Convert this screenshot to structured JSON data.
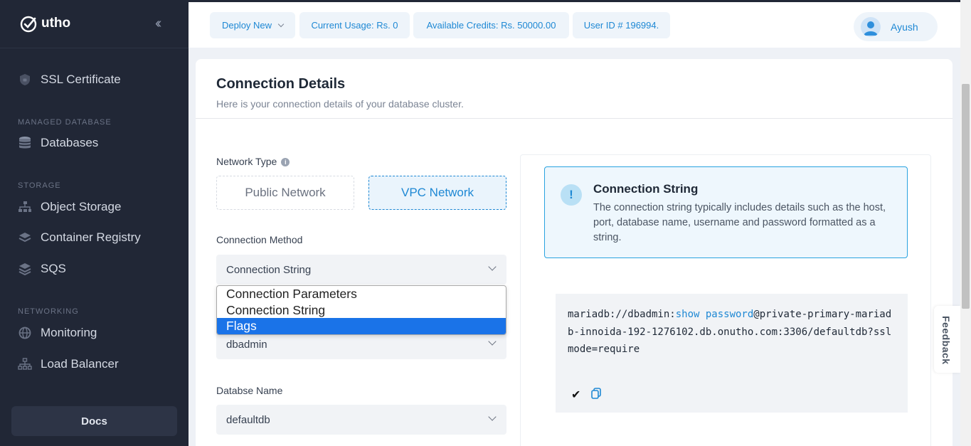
{
  "sidebar": {
    "brand": "utho",
    "sections": [
      {
        "label": "",
        "items": [
          {
            "label": "SSL Certificate",
            "icon": "shield-icon"
          }
        ]
      },
      {
        "label": "MANAGED DATABASE",
        "items": [
          {
            "label": "Databases",
            "icon": "database-icon"
          }
        ]
      },
      {
        "label": "STORAGE",
        "items": [
          {
            "label": "Object Storage",
            "icon": "object-storage-icon"
          },
          {
            "label": "Container Registry",
            "icon": "layers-icon"
          },
          {
            "label": "SQS",
            "icon": "stack-icon"
          }
        ]
      },
      {
        "label": "NETWORKING",
        "items": [
          {
            "label": "Monitoring",
            "icon": "globe-icon"
          },
          {
            "label": "Load Balancer",
            "icon": "network-icon"
          }
        ]
      }
    ],
    "docs_label": "Docs"
  },
  "topbar": {
    "deploy_new": "Deploy New",
    "current_usage": "Current Usage: Rs. 0",
    "available_credits": "Available Credits: Rs. 50000.00",
    "user_id": "User ID # 196994.",
    "user_name": "Ayush"
  },
  "card": {
    "title": "Connection Details",
    "subtitle": "Here is your connection details of your database cluster.",
    "network_type_label": "Network Type",
    "network_public": "Public Network",
    "network_vpc": "VPC Network",
    "connection_method_label": "Connection Method",
    "connection_method_value": "Connection String",
    "user_value": "dbadmin",
    "database_name_label": "Databse Name",
    "database_name_value": "defaultdb"
  },
  "dropdown": {
    "options": [
      "Connection Parameters",
      "Connection String",
      "Flags"
    ],
    "highlighted": "Flags"
  },
  "info": {
    "title": "Connection String",
    "description": "The connection string typically includes details such as the host, port, database name, username and password formatted as a string."
  },
  "connection_string": {
    "prefix": "mariadb://dbadmin:",
    "password_link": "show password",
    "suffix": "@private-primary-mariadb-innoida-192-1276102.db.onutho.com:3306/defaultdb?sslmode=require"
  },
  "feedback_label": "Feedback",
  "colors": {
    "accent": "#1e88d4",
    "sidebar_bg": "#212736",
    "highlight": "#1a73e8"
  }
}
